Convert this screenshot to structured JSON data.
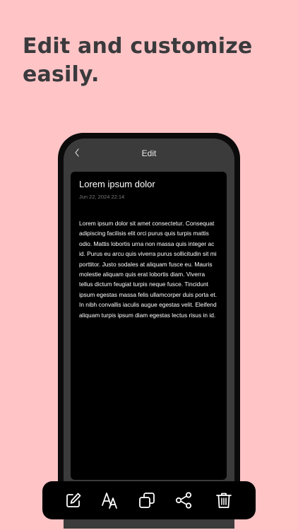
{
  "headline": "Edit and customize easily.",
  "screen": {
    "nav": {
      "back_icon": "chevron-left-icon",
      "title": "Edit"
    },
    "note": {
      "title": "Lorem ipsum dolor",
      "date": "Jun 22, 2024 22:14",
      "body": "Lorem ipsum dolor sit amet consectetur. Consequat adipiscing facilisis elit orci purus quis turpis mattis odio. Mattis lobortis urna non massa quis integer ac id. Purus eu arcu quis viverra purus sollicitudin sit mi porttitor. Justo sodales at aliquam fusce eu. Mauris molestie aliquam quis erat lobortis diam. Viverra tellus dictum feugiat turpis neque fusce. Tincidunt ipsum egestas massa felis ullamcorper duis porta et. In nibh convallis iaculis augue egestas velit. Eleifend aliquam turpis ipsum diam egestas lectus risus in id."
    }
  },
  "toolbar": {
    "items": [
      "edit-icon",
      "font-size-icon",
      "copy-icon",
      "share-icon",
      "trash-icon"
    ]
  },
  "colors": {
    "background": "#ffc4c6",
    "headline": "#3a3a3c",
    "phone_frame": "#0b0b0b",
    "screen": "#3b3b3b",
    "note_card": "#000000",
    "toolbar": "#000000",
    "icon": "#ffffff"
  }
}
